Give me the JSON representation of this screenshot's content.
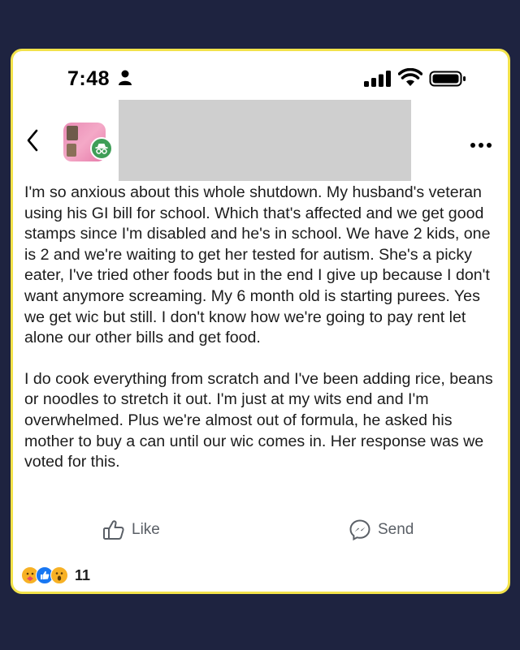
{
  "status_bar": {
    "time": "7:48"
  },
  "post": {
    "paragraphs": [
      "I'm so anxious about this whole shutdown. My husband's veteran using his GI bill for school. Which that's affected and we get good stamps since I'm disabled and he's in school. We have 2 kids, one is 2 and we're waiting to get her tested for autism. She's a picky eater, I've tried other foods but in the end I give up because I don't want anymore screaming. My 6 month old is starting purees. Yes we get wic but still. I don't know how we're going to pay rent let alone our other bills and get food.",
      "I do cook everything from scratch and I've been adding rice, beans or noodles to stretch it out. I'm just at my wits end and I'm overwhelmed. Plus we're almost out of formula, he asked his mother to buy a can until our wic comes in. Her response was we voted for this."
    ]
  },
  "actions": {
    "like_label": "Like",
    "send_label": "Send"
  },
  "reactions": {
    "count": "11",
    "types": [
      "care",
      "like",
      "wow"
    ]
  },
  "colors": {
    "background": "#1e2340",
    "frame_border": "#f2e24a",
    "anonymous_badge": "#3e9e57",
    "like_blue": "#1877f2"
  }
}
